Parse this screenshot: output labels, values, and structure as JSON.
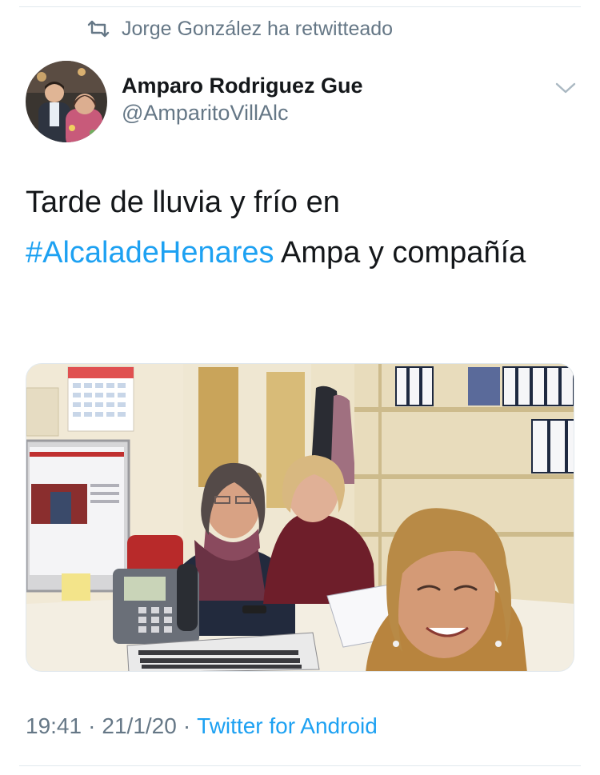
{
  "social_context": {
    "text": "Jorge González ha retwitteado",
    "icon": "retweet-icon"
  },
  "author": {
    "display_name": "Amparo Rodriguez Gue",
    "handle": "@AmparitoVillAlc"
  },
  "tweet": {
    "text_before": "Tarde de lluvia y frío en ",
    "hashtag": "#AlcaladeHenares",
    "text_after": " Ampa y compañía"
  },
  "meta": {
    "time": "19:41",
    "separator1": "·",
    "date": "21/1/20",
    "separator2": "·",
    "source": "Twitter for Android"
  },
  "colors": {
    "link": "#1da1f2",
    "secondary_text": "#657786",
    "primary_text": "#14171a",
    "divider": "#e1e8ed"
  }
}
